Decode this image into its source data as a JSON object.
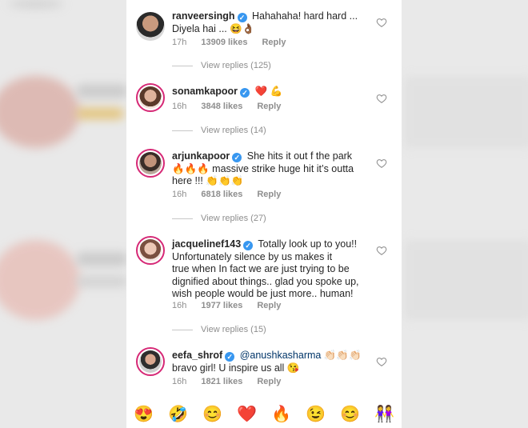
{
  "comments": [
    {
      "username": "ranveersingh",
      "verified": true,
      "text": "Hahahaha! hard hard ...",
      "text2": "Diyela hai ... 😆👌🏾",
      "time": "17h",
      "likes": "13909 likes",
      "reply": "Reply",
      "view_replies": "View replies (125)"
    },
    {
      "username": "sonamkapoor",
      "verified": true,
      "text": "❤️ 💪",
      "time": "16h",
      "likes": "3848 likes",
      "reply": "Reply",
      "view_replies": "View replies (14)"
    },
    {
      "username": "arjunkapoor",
      "verified": true,
      "text": "She hits it out f the park",
      "text2": "🔥🔥🔥 massive strike huge hit it’s outta",
      "text3": "here !!! 👏👏👏",
      "time": "16h",
      "likes": "6818 likes",
      "reply": "Reply",
      "view_replies": "View replies (27)"
    },
    {
      "username": "jacquelinef143",
      "verified": true,
      "text": "Totally look up to you!!",
      "text2": "Unfortunately silence by us makes it",
      "text3": "true when In fact we are just trying to be",
      "text4": "dignified about things.. glad you spoke up,",
      "text5": "wish people would be just more.. human!",
      "time": "16h",
      "likes": "1977 likes",
      "reply": "Reply",
      "view_replies": "View replies (15)"
    },
    {
      "username": "eefa_shrof",
      "verified": true,
      "mention": "@anushkasharma",
      "text": "👏🏻👏🏻👏🏻",
      "text2": "bravo girl! U inspire us all 😘",
      "time": "16h",
      "likes": "1821 likes",
      "reply": "Reply"
    }
  ],
  "emoji_bar": [
    "😍",
    "🤣",
    "😊",
    "❤️",
    "🔥",
    "😉",
    "😊",
    "👭"
  ],
  "icons": {
    "like": "heart-outline-icon",
    "verified": "verified-badge-icon"
  },
  "colors": {
    "verified": "#3897f0",
    "story_ring": "#d62976",
    "meta_text": "#8e8e8e",
    "mention": "#003569"
  }
}
